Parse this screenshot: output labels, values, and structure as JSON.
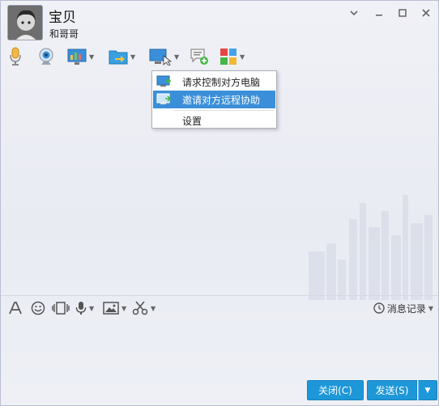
{
  "header": {
    "contact_name": "宝贝",
    "contact_subtitle": "和哥哥"
  },
  "window_controls": [
    "chevron-down-icon",
    "minimize-icon",
    "maximize-icon",
    "close-icon"
  ],
  "toolbar": {
    "items": [
      "microphone-icon",
      "webcam-icon",
      "screen-share-icon",
      "file-transfer-icon",
      "remote-assist-icon",
      "message-add-icon",
      "apps-icon"
    ]
  },
  "remote_menu": {
    "items": [
      {
        "label": "请求控制对方电脑"
      },
      {
        "label": "邀请对方远程协助"
      },
      {
        "label": "设置"
      }
    ]
  },
  "input_toolbar": {
    "items": [
      "font-icon",
      "emoji-icon",
      "shake-icon",
      "voice-icon",
      "image-icon",
      "screenshot-icon"
    ],
    "history_label": "消息记录"
  },
  "buttons": {
    "close_label": "关闭(C)",
    "send_label": "发送(S)"
  },
  "colors": {
    "accent": "#1e97d8",
    "menu_highlight": "#3a8fd8"
  }
}
